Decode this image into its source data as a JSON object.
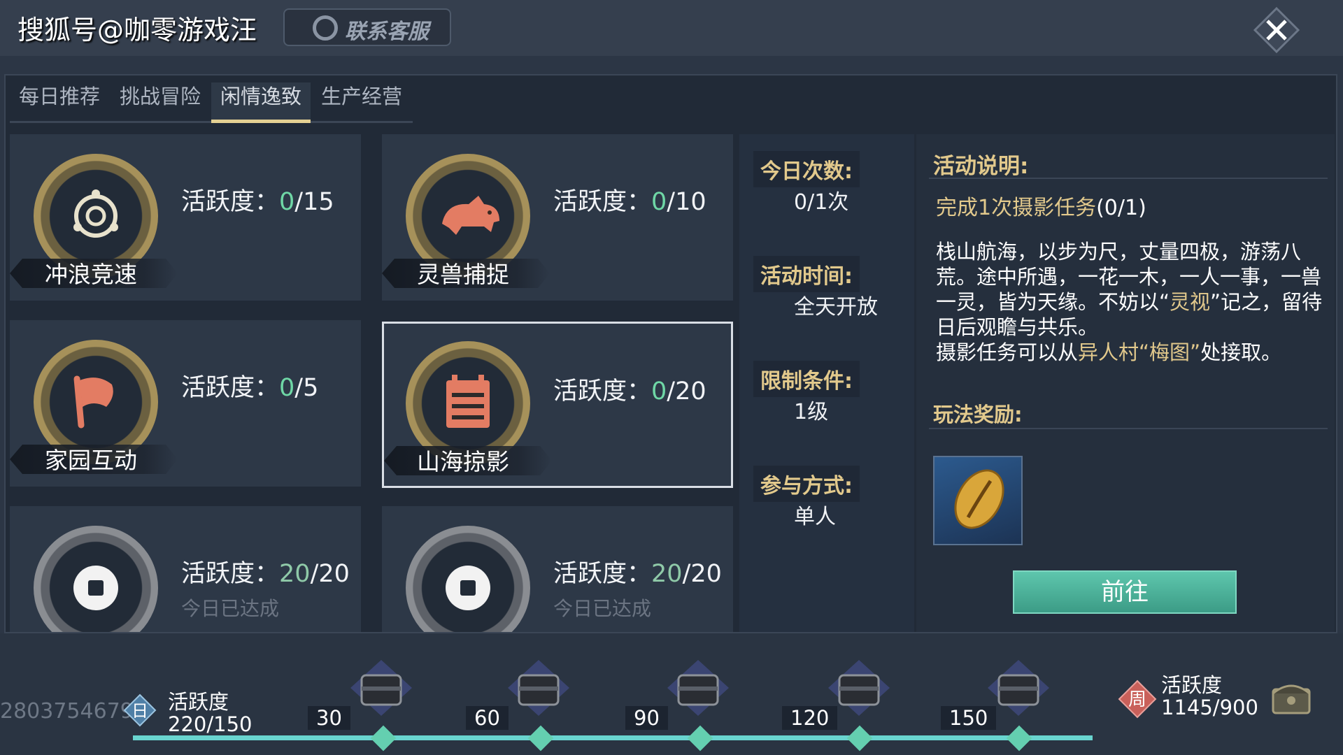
{
  "watermark": "搜狐号@咖零游戏汪",
  "header": {
    "support_label": "联系客服"
  },
  "tabs": [
    {
      "label": "每日推荐",
      "active": false
    },
    {
      "label": "挑战冒险",
      "active": false
    },
    {
      "label": "闲情逸致",
      "active": true
    },
    {
      "label": "生产经营",
      "active": false
    }
  ],
  "activity_prefix": "活跃度：",
  "cards": [
    {
      "name": "冲浪竞速",
      "icon": "target-ring-icon",
      "current": "0",
      "max": "/15",
      "done_note": "",
      "selected": false
    },
    {
      "name": "灵兽捕捉",
      "icon": "beast-icon",
      "current": "0",
      "max": "/10",
      "done_note": "",
      "selected": false
    },
    {
      "name": "家园互动",
      "icon": "flag-icon",
      "current": "0",
      "max": "/5",
      "done_note": "",
      "selected": false
    },
    {
      "name": "山海掠影",
      "icon": "calendar-icon",
      "current": "0",
      "max": "/20",
      "done_note": "",
      "selected": true
    },
    {
      "name": "",
      "icon": "coin-icon",
      "current": "20",
      "max": "/20",
      "done_note": "今日已达成",
      "selected": false
    },
    {
      "name": "",
      "icon": "coin-icon",
      "current": "20",
      "max": "/20",
      "done_note": "今日已达成",
      "selected": false
    }
  ],
  "info": {
    "today_count_label": "今日次数:",
    "today_count_value": "0/1次",
    "time_label": "活动时间:",
    "time_value": "全天开放",
    "limit_label": "限制条件:",
    "limit_value": "1级",
    "mode_label": "参与方式:",
    "mode_value": "单人"
  },
  "description": {
    "heading": "活动说明:",
    "task_text": "完成1次摄影任务",
    "task_progress": "(0/1)",
    "line1": "栈山航海，以步为尺，丈量四极，游荡八荒。途中所遇，一花一木，一人一事，一兽一灵，皆为天缘。不妨以“",
    "line1_hl": "灵视",
    "line2": "”记之，留待日后观瞻与共乐。",
    "line3": "摄影任务可以从",
    "line3_hl": "异人村“梅图”",
    "line4": "处接取。",
    "reward_heading": "玩法奖励:",
    "reward_icon": "shell-icon",
    "go_label": "前往"
  },
  "progress": {
    "uid": "2803754679",
    "day_badge": "日",
    "daily_label": "活跃度",
    "daily_value": "220/150",
    "daily_fill_fraction": 1.0,
    "milestones": [
      "30",
      "60",
      "90",
      "120",
      "150"
    ],
    "week_badge": "周",
    "weekly_label": "活跃度",
    "weekly_value": "1145/900"
  },
  "colors": {
    "accent_gold": "#e2c98c",
    "progress_green": "#6fd7a6",
    "go_button": "#4fb39c"
  }
}
